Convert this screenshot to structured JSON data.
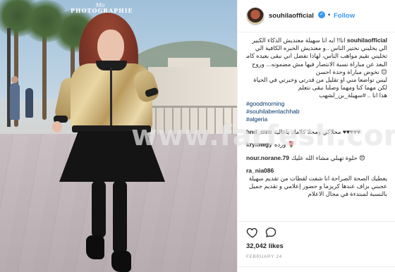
{
  "photo": {
    "watermark_script": "Mo",
    "watermark_text": "PHOTOGRAPHIE"
  },
  "site_watermark": "www.farfesh.com",
  "header": {
    "username": "souhilaofficial",
    "verified_glyph": "✓",
    "separator": "•",
    "follow_label": "Follow"
  },
  "caption": {
    "username": "souhilaofficial",
    "lines": [
      "انا!! ايه انا سهيلة معنديش الذكاء الكبير",
      "الي يخليني نختير الناس ..و معنديش الخبره الكافية الي",
      "تخليني نقيم مواهب الناس، لهاذا نفضل اني نبقى بعيده كامل",
      "البعد عن مباراة نسبة الانتصار فيها مش مضمونه... وروح",
      "😊 نخوض مباراة وحدة احسن",
      "ليس تواضعا مني او تقليل من قدرتي وخبرتي في الحياة",
      "لكن مهما كنا ومهما وصلنا نبقى نتعلم",
      "هذا انا .. #سهيلة_بن_لشهب"
    ],
    "tags": [
      "#goodmorning",
      "#souhilabenlachhab",
      "#algeria"
    ]
  },
  "comments": [
    {
      "user": "hnd_mrn",
      "text": "♥♥♥♥♥ محلاكي ومحلا كلامك ياغالية"
    },
    {
      "user": "krymwgy",
      "text": "🌹 ورده"
    },
    {
      "user": "nour.norane.79",
      "text": "😍 حلوة تهبلي مشاء الله عليك"
    },
    {
      "user": "ra_nia086",
      "text": "يعطيك الصحة الصراحة انا شفت لقطات من تقديم سهيلة عجبني بزاف عندها كريزما و حضور إعلامي و تقديم جميل بالنسبة لمبتدءة في مجال الاعلام"
    }
  ],
  "actions": {
    "heart_icon": "heart-outline",
    "comment_icon": "speech-bubble",
    "likes": "32,042 likes",
    "date": "FEBRUARY 24"
  }
}
